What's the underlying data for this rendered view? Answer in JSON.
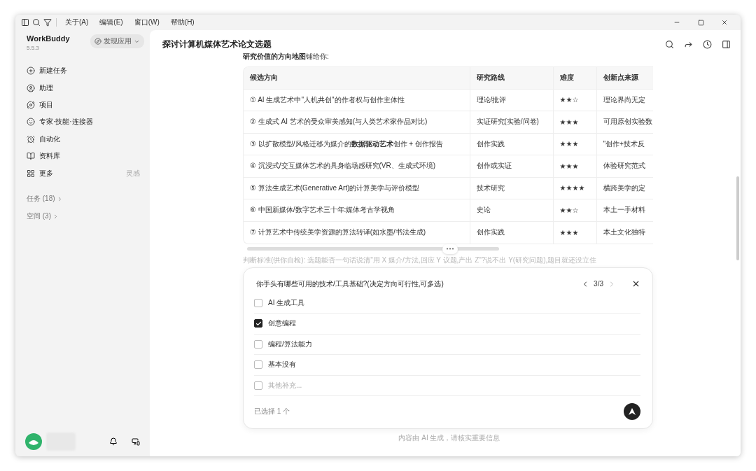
{
  "menu": [
    "关于(A)",
    "编辑(E)",
    "窗口(W)",
    "帮助(H)"
  ],
  "sidebar": {
    "app_name": "WorkBuddy",
    "version": "5.5.3",
    "discover": "发现应用",
    "items": [
      {
        "label": "新建任务"
      },
      {
        "label": "助理"
      },
      {
        "label": "项目"
      },
      {
        "label": "专家·技能·连接器"
      },
      {
        "label": "自动化"
      },
      {
        "label": "资料库"
      },
      {
        "label": "更多",
        "hint": "灵感"
      }
    ],
    "sections": [
      "任务 (18)",
      "空间 (3)"
    ]
  },
  "chat": {
    "title": "探讨计算机媒体艺术论文选题",
    "intro": "**研究价值的方向地图**铺给你:",
    "table": {
      "columns": [
        "候选方向",
        "研究路线",
        "难度",
        "创新点来源"
      ],
      "rows": [
        [
          "① AI 生成艺术中\"人机共创\"的作者权与创作主体性",
          "理论/批评",
          "★★☆",
          "理论界尚无定"
        ],
        [
          "② 生成式 AI 艺术的受众审美感知(与人类艺术家作品对比)",
          "实证研究(实验/问卷)",
          "★★★",
          "可用原创实验数"
        ],
        [
          "③ 以扩散模型/风格迁移为媒介的**数据驱动艺术**创作 + 创作报告",
          "创作实践",
          "★★★",
          "\"创作+技术反"
        ],
        [
          "④ 沉浸式/交互媒体艺术的具身临场感研究(VR、生成式环境)",
          "创作或实证",
          "★★★",
          "体验研究范式"
        ],
        [
          "⑤ 算法生成艺术(Generative Art)的计算美学与评价模型",
          "技术研究",
          "★★★★",
          "横跨美学的定"
        ],
        [
          "⑥ 中国新媒体/数字艺术三十年:媒体考古学视角",
          "史论",
          "★★☆",
          "本土一手材料"
        ],
        [
          "⑦ 计算艺术中传统美学资源的算法转译(如水墨/书法生成)",
          "创作实践",
          "★★★",
          "本土文化独特"
        ]
      ]
    },
    "faded_note": "判断标准(供你自检): 选题能否一句话说清\"用 X 媒介/方法,回应 Y 议题,产出 Z\"?说不出 Y(研究问题),题目就还没立住",
    "question": {
      "text": "你手头有哪些可用的技术/工具基础?(决定方向可行性,可多选)",
      "pager": "3/3",
      "prev_disabled": false,
      "next_disabled": true,
      "options": [
        {
          "kind": "option",
          "label": "AI 生成工具",
          "checked": false
        },
        {
          "kind": "option",
          "label": "创意编程",
          "checked": true
        },
        {
          "kind": "option",
          "label": "编程/算法能力",
          "checked": false
        },
        {
          "kind": "option",
          "label": "基本没有",
          "checked": false
        },
        {
          "kind": "other",
          "placeholder": "其他补充...",
          "checked": false
        }
      ],
      "selected_count": "已选择 1 个"
    },
    "footer": "内容由 AI 生成，请核实重要信息"
  }
}
